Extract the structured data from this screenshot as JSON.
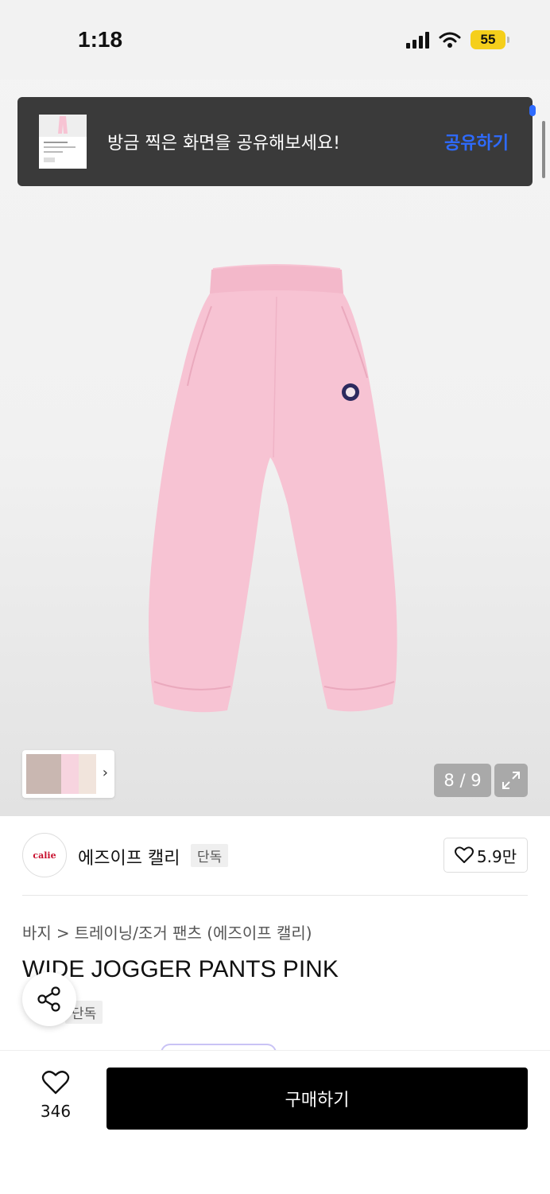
{
  "status_bar": {
    "time": "1:18",
    "battery": "55"
  },
  "toast": {
    "message": "방금 찍은 화면을 공유해보세요!",
    "action": "공유하기"
  },
  "gallery": {
    "counter": "8 / 9",
    "colors": {
      "pants": "#f7c3d3",
      "patch": "#2c2a5e"
    }
  },
  "brand": {
    "logo_text": "calie",
    "name": "에즈이프 캘리",
    "badge": "단독",
    "likes": "5.9만"
  },
  "product": {
    "breadcrumb": [
      "바지",
      "트레이닝/조거 팬츠 (에즈이프 캘리)"
    ],
    "title": "WIDE JOGGER PANTS PINK",
    "badge": "단독"
  },
  "bottom_bar": {
    "wish_count": "346",
    "buy_label": "구매하기"
  }
}
